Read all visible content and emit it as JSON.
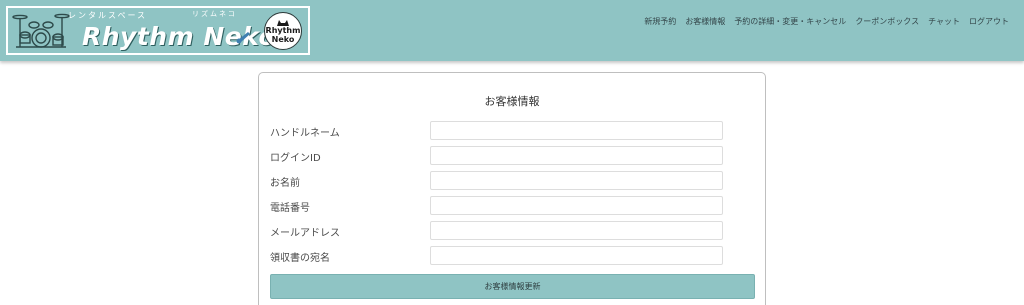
{
  "header": {
    "logo": {
      "tagline": "レンタルスペース",
      "ruby": "リズムネコ",
      "title": "Rhythm Neko",
      "badge_line1": "Rhythm",
      "badge_line2": "Neko"
    },
    "nav": [
      {
        "label": "新規予約"
      },
      {
        "label": "お客様情報"
      },
      {
        "label": "予約の詳細・変更・キャンセル"
      },
      {
        "label": "クーポンボックス"
      },
      {
        "label": "チャット"
      },
      {
        "label": "ログアウト"
      }
    ]
  },
  "form": {
    "title": "お客様情報",
    "fields": [
      {
        "label": "ハンドルネーム",
        "value": ""
      },
      {
        "label": "ログインID",
        "value": ""
      },
      {
        "label": "お名前",
        "value": ""
      },
      {
        "label": "電話番号",
        "value": ""
      },
      {
        "label": "メールアドレス",
        "value": ""
      },
      {
        "label": "領収書の宛名",
        "value": ""
      }
    ],
    "submit_label": "お客様情報更新"
  },
  "colors": {
    "accent": "#8fc4c4",
    "header_text": "#34464a"
  }
}
